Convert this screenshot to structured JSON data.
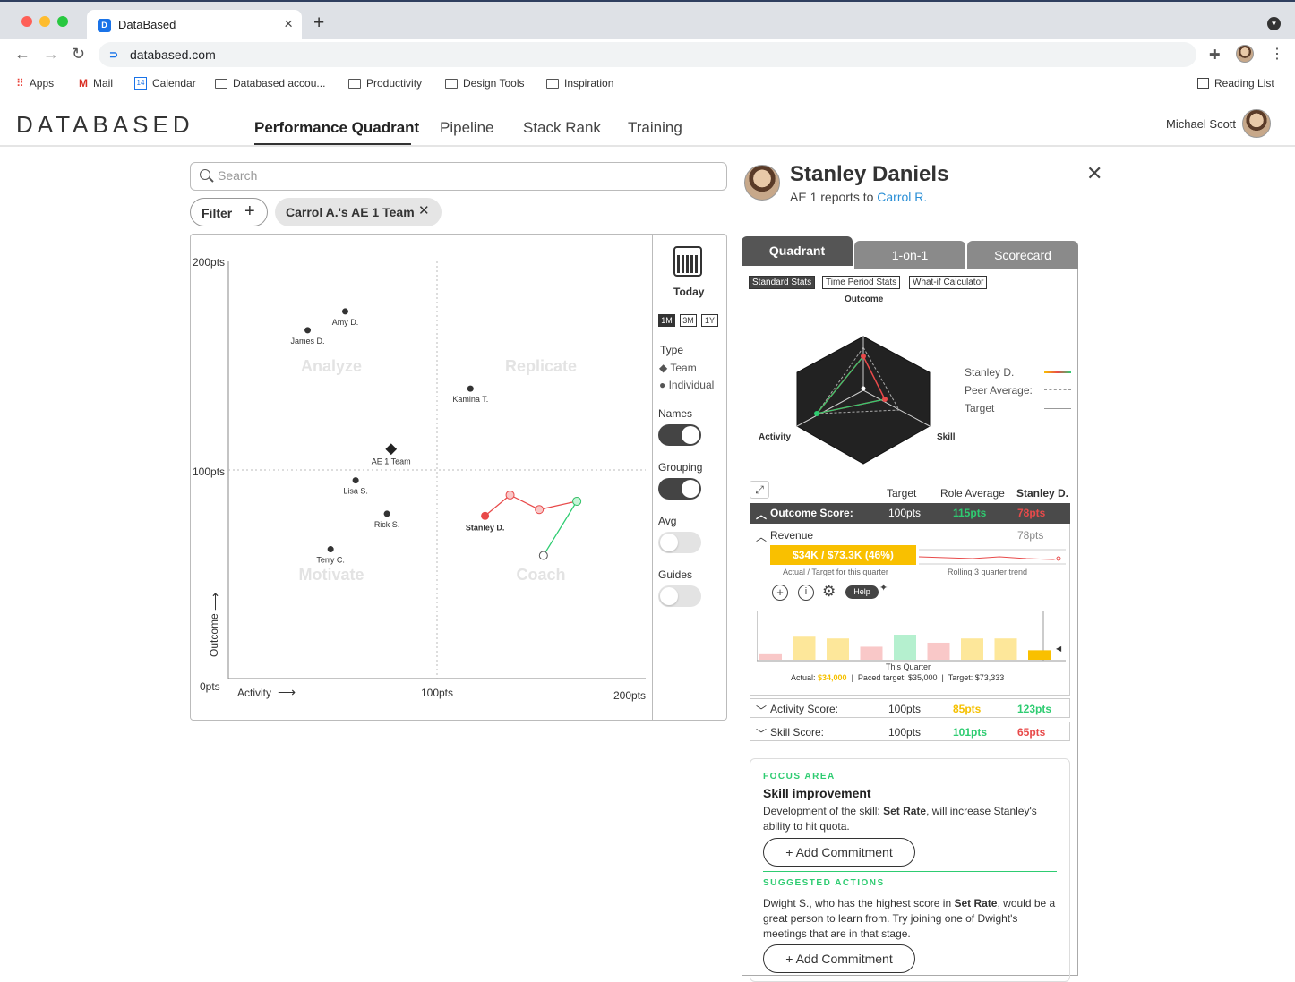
{
  "browser": {
    "tab_title": "DataBased",
    "url": "databased.com",
    "bookmarks": [
      "Apps",
      "Mail",
      "Calendar",
      "Databased accou...",
      "Productivity",
      "Design Tools",
      "Inspiration"
    ],
    "reading_list": "Reading List"
  },
  "header": {
    "logo": "DATABASED",
    "nav": [
      "Performance Quadrant",
      "Pipeline",
      "Stack Rank",
      "Training"
    ],
    "user_name": "Michael Scott"
  },
  "search": {
    "placeholder": "Search",
    "value": ""
  },
  "filter": {
    "label": "Filter",
    "chip": "Carrol A.'s AE 1 Team"
  },
  "quadrant": {
    "y_ticks": [
      "200pts",
      "100pts",
      "0pts"
    ],
    "x_ticks": [
      "100pts",
      "200pts"
    ],
    "x_axis_label": "Activity",
    "y_axis_label": "Outcome",
    "quadrant_labels": [
      "Analyze",
      "Replicate",
      "Motivate",
      "Coach"
    ],
    "points": [
      {
        "name": "Amy D.",
        "type": "individual",
        "activity": 56,
        "outcome": 176
      },
      {
        "name": "James D.",
        "type": "individual",
        "activity": 38,
        "outcome": 167
      },
      {
        "name": "Kamina T.",
        "type": "individual",
        "activity": 116,
        "outcome": 139
      },
      {
        "name": "AE 1 Team",
        "type": "team",
        "activity": 78,
        "outcome": 110
      },
      {
        "name": "Lisa S.",
        "type": "individual",
        "activity": 61,
        "outcome": 95
      },
      {
        "name": "Rick S.",
        "type": "individual",
        "activity": 76,
        "outcome": 79
      },
      {
        "name": "Terry C.",
        "type": "individual",
        "activity": 49,
        "outcome": 62
      },
      {
        "name": "Stanley D.",
        "type": "individual",
        "activity": 123,
        "outcome": 78
      }
    ],
    "stanley_outcome_trail": [
      [
        123,
        78
      ],
      [
        135,
        88
      ],
      [
        149,
        81
      ],
      [
        167,
        85
      ]
    ],
    "stanley_activity_trail": [
      [
        167,
        85
      ],
      [
        151,
        59
      ]
    ]
  },
  "controls": {
    "date_label": "Today",
    "periods": [
      "1M",
      "3M",
      "1Y"
    ],
    "type_label": "Type",
    "type_team": "Team",
    "type_individual": "Individual",
    "names_label": "Names",
    "grouping_label": "Grouping",
    "avg_label": "Avg",
    "guides_label": "Guides"
  },
  "profile": {
    "name": "Stanley Daniels",
    "role": "AE 1 reports to",
    "manager": "Carrol R.",
    "tabs": [
      "Quadrant",
      "1-on-1",
      "Scorecard"
    ],
    "substats": [
      "Standard Stats",
      "Time Period Stats",
      "What-if Calculator"
    ],
    "radar_axes": [
      "Outcome",
      "Activity",
      "Skill"
    ],
    "legend": [
      "Stanley D.",
      "Peer Average:",
      "Target"
    ],
    "table_headers": [
      "Target",
      "Role Average",
      "Stanley D."
    ],
    "outcome": {
      "label": "Outcome Score:",
      "target": "100pts",
      "avg": "115pts",
      "stanley": "78pts"
    },
    "revenue": {
      "label": "Revenue",
      "score": "78pts",
      "bar_text": "$34K / $73.3K (46%)",
      "bar_caption": "Actual / Target for this quarter",
      "trend_caption": "Rolling 3 quarter trend",
      "help": "Help",
      "quarter_caption": "This Quarter",
      "actual_label": "Actual:",
      "actual_value": "$34,000",
      "paced": "Paced target: $35,000",
      "target": "Target: $73,333",
      "bar_values": [
        0.22,
        0.92,
        0.85,
        0.52,
        1.0,
        0.68,
        0.85,
        0.85,
        0.38
      ]
    },
    "activity": {
      "label": "Activity Score:",
      "target": "100pts",
      "avg": "85pts",
      "stanley": "123pts"
    },
    "skill": {
      "label": "Skill Score:",
      "target": "100pts",
      "avg": "101pts",
      "stanley": "65pts"
    },
    "focus": {
      "section": "FOCUS AREA",
      "title": "Skill improvement",
      "text_pre": "Development of the skill: ",
      "text_bold": "Set Rate",
      "text_post": ", will increase Stanley's ability to hit quota.",
      "button": "+ Add Commitment"
    },
    "suggested": {
      "section": "SUGGESTED ACTIONS",
      "text_pre": "Dwight S., who has the highest score in ",
      "text_bold": "Set Rate",
      "text_post": ", would be a great person to learn from. Try joining one of Dwight's meetings that are in that stage.",
      "button": "+ Add Commitment"
    }
  },
  "colors": {
    "accent_red": "#e84a4a",
    "accent_green": "#2ecc71",
    "accent_yellow": "#f9c000",
    "link": "#2a8fd6"
  }
}
